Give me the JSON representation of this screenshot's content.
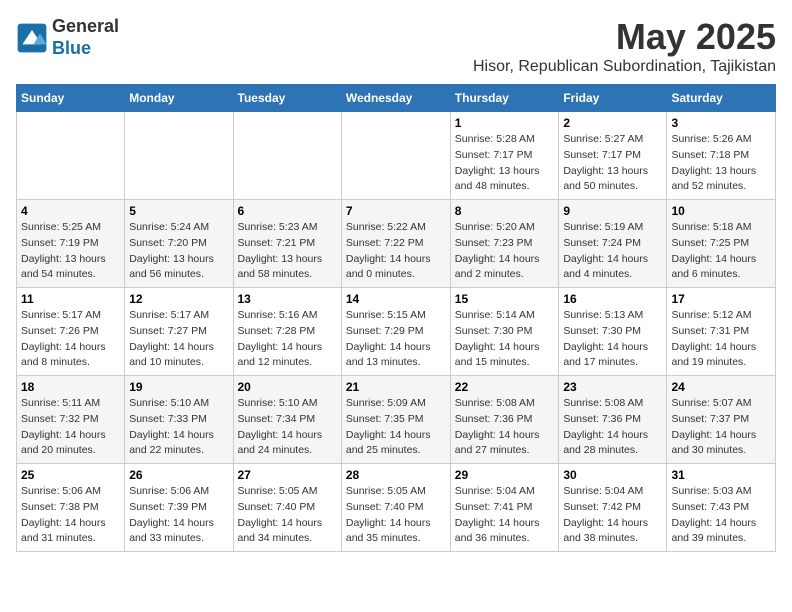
{
  "header": {
    "logo_line1": "General",
    "logo_line2": "Blue",
    "title": "May 2025",
    "subtitle": "Hisor, Republican Subordination, Tajikistan"
  },
  "weekdays": [
    "Sunday",
    "Monday",
    "Tuesday",
    "Wednesday",
    "Thursday",
    "Friday",
    "Saturday"
  ],
  "weeks": [
    [
      {
        "day": "",
        "sunrise": "",
        "sunset": "",
        "daylight": ""
      },
      {
        "day": "",
        "sunrise": "",
        "sunset": "",
        "daylight": ""
      },
      {
        "day": "",
        "sunrise": "",
        "sunset": "",
        "daylight": ""
      },
      {
        "day": "",
        "sunrise": "",
        "sunset": "",
        "daylight": ""
      },
      {
        "day": "1",
        "sunrise": "Sunrise: 5:28 AM",
        "sunset": "Sunset: 7:17 PM",
        "daylight": "Daylight: 13 hours and 48 minutes."
      },
      {
        "day": "2",
        "sunrise": "Sunrise: 5:27 AM",
        "sunset": "Sunset: 7:17 PM",
        "daylight": "Daylight: 13 hours and 50 minutes."
      },
      {
        "day": "3",
        "sunrise": "Sunrise: 5:26 AM",
        "sunset": "Sunset: 7:18 PM",
        "daylight": "Daylight: 13 hours and 52 minutes."
      }
    ],
    [
      {
        "day": "4",
        "sunrise": "Sunrise: 5:25 AM",
        "sunset": "Sunset: 7:19 PM",
        "daylight": "Daylight: 13 hours and 54 minutes."
      },
      {
        "day": "5",
        "sunrise": "Sunrise: 5:24 AM",
        "sunset": "Sunset: 7:20 PM",
        "daylight": "Daylight: 13 hours and 56 minutes."
      },
      {
        "day": "6",
        "sunrise": "Sunrise: 5:23 AM",
        "sunset": "Sunset: 7:21 PM",
        "daylight": "Daylight: 13 hours and 58 minutes."
      },
      {
        "day": "7",
        "sunrise": "Sunrise: 5:22 AM",
        "sunset": "Sunset: 7:22 PM",
        "daylight": "Daylight: 14 hours and 0 minutes."
      },
      {
        "day": "8",
        "sunrise": "Sunrise: 5:20 AM",
        "sunset": "Sunset: 7:23 PM",
        "daylight": "Daylight: 14 hours and 2 minutes."
      },
      {
        "day": "9",
        "sunrise": "Sunrise: 5:19 AM",
        "sunset": "Sunset: 7:24 PM",
        "daylight": "Daylight: 14 hours and 4 minutes."
      },
      {
        "day": "10",
        "sunrise": "Sunrise: 5:18 AM",
        "sunset": "Sunset: 7:25 PM",
        "daylight": "Daylight: 14 hours and 6 minutes."
      }
    ],
    [
      {
        "day": "11",
        "sunrise": "Sunrise: 5:17 AM",
        "sunset": "Sunset: 7:26 PM",
        "daylight": "Daylight: 14 hours and 8 minutes."
      },
      {
        "day": "12",
        "sunrise": "Sunrise: 5:17 AM",
        "sunset": "Sunset: 7:27 PM",
        "daylight": "Daylight: 14 hours and 10 minutes."
      },
      {
        "day": "13",
        "sunrise": "Sunrise: 5:16 AM",
        "sunset": "Sunset: 7:28 PM",
        "daylight": "Daylight: 14 hours and 12 minutes."
      },
      {
        "day": "14",
        "sunrise": "Sunrise: 5:15 AM",
        "sunset": "Sunset: 7:29 PM",
        "daylight": "Daylight: 14 hours and 13 minutes."
      },
      {
        "day": "15",
        "sunrise": "Sunrise: 5:14 AM",
        "sunset": "Sunset: 7:30 PM",
        "daylight": "Daylight: 14 hours and 15 minutes."
      },
      {
        "day": "16",
        "sunrise": "Sunrise: 5:13 AM",
        "sunset": "Sunset: 7:30 PM",
        "daylight": "Daylight: 14 hours and 17 minutes."
      },
      {
        "day": "17",
        "sunrise": "Sunrise: 5:12 AM",
        "sunset": "Sunset: 7:31 PM",
        "daylight": "Daylight: 14 hours and 19 minutes."
      }
    ],
    [
      {
        "day": "18",
        "sunrise": "Sunrise: 5:11 AM",
        "sunset": "Sunset: 7:32 PM",
        "daylight": "Daylight: 14 hours and 20 minutes."
      },
      {
        "day": "19",
        "sunrise": "Sunrise: 5:10 AM",
        "sunset": "Sunset: 7:33 PM",
        "daylight": "Daylight: 14 hours and 22 minutes."
      },
      {
        "day": "20",
        "sunrise": "Sunrise: 5:10 AM",
        "sunset": "Sunset: 7:34 PM",
        "daylight": "Daylight: 14 hours and 24 minutes."
      },
      {
        "day": "21",
        "sunrise": "Sunrise: 5:09 AM",
        "sunset": "Sunset: 7:35 PM",
        "daylight": "Daylight: 14 hours and 25 minutes."
      },
      {
        "day": "22",
        "sunrise": "Sunrise: 5:08 AM",
        "sunset": "Sunset: 7:36 PM",
        "daylight": "Daylight: 14 hours and 27 minutes."
      },
      {
        "day": "23",
        "sunrise": "Sunrise: 5:08 AM",
        "sunset": "Sunset: 7:36 PM",
        "daylight": "Daylight: 14 hours and 28 minutes."
      },
      {
        "day": "24",
        "sunrise": "Sunrise: 5:07 AM",
        "sunset": "Sunset: 7:37 PM",
        "daylight": "Daylight: 14 hours and 30 minutes."
      }
    ],
    [
      {
        "day": "25",
        "sunrise": "Sunrise: 5:06 AM",
        "sunset": "Sunset: 7:38 PM",
        "daylight": "Daylight: 14 hours and 31 minutes."
      },
      {
        "day": "26",
        "sunrise": "Sunrise: 5:06 AM",
        "sunset": "Sunset: 7:39 PM",
        "daylight": "Daylight: 14 hours and 33 minutes."
      },
      {
        "day": "27",
        "sunrise": "Sunrise: 5:05 AM",
        "sunset": "Sunset: 7:40 PM",
        "daylight": "Daylight: 14 hours and 34 minutes."
      },
      {
        "day": "28",
        "sunrise": "Sunrise: 5:05 AM",
        "sunset": "Sunset: 7:40 PM",
        "daylight": "Daylight: 14 hours and 35 minutes."
      },
      {
        "day": "29",
        "sunrise": "Sunrise: 5:04 AM",
        "sunset": "Sunset: 7:41 PM",
        "daylight": "Daylight: 14 hours and 36 minutes."
      },
      {
        "day": "30",
        "sunrise": "Sunrise: 5:04 AM",
        "sunset": "Sunset: 7:42 PM",
        "daylight": "Daylight: 14 hours and 38 minutes."
      },
      {
        "day": "31",
        "sunrise": "Sunrise: 5:03 AM",
        "sunset": "Sunset: 7:43 PM",
        "daylight": "Daylight: 14 hours and 39 minutes."
      }
    ]
  ]
}
